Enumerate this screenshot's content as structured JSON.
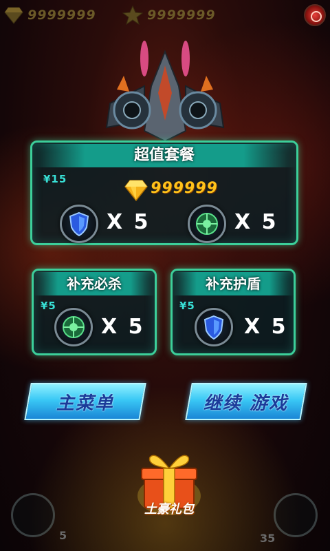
{
  "hud": {
    "gems": "9999999",
    "stars": "9999999",
    "gem_icon": "diamond-icon",
    "star_icon": "star-icon",
    "settings_icon": "settings-icon"
  },
  "package": {
    "title": "超值套餐",
    "price": "¥15",
    "gem_amount": "999999",
    "items": [
      {
        "icon": "shield-icon",
        "qty": "X 5"
      },
      {
        "icon": "bomb-icon",
        "qty": "X 5"
      }
    ]
  },
  "refill_special": {
    "title": "补充必杀",
    "price": "¥5",
    "icon": "bomb-icon",
    "qty": "X 5"
  },
  "refill_shield": {
    "title": "补充护盾",
    "price": "¥5",
    "icon": "shield-icon",
    "qty": "X 5"
  },
  "buttons": {
    "main_menu": "主菜单",
    "continue": "继续 游戏"
  },
  "gift": {
    "label": "土豪礼包",
    "icon": "gift-box-icon"
  },
  "bottom": {
    "left_count": "5",
    "right_count": "35"
  },
  "colors": {
    "panel_border": "#3ccf9a",
    "title_bar": "#14aa96",
    "price_text": "#38e0d6",
    "button_fill": "#3ac8f5",
    "button_text": "#1a3b9a",
    "gem": "#f5b21a"
  }
}
